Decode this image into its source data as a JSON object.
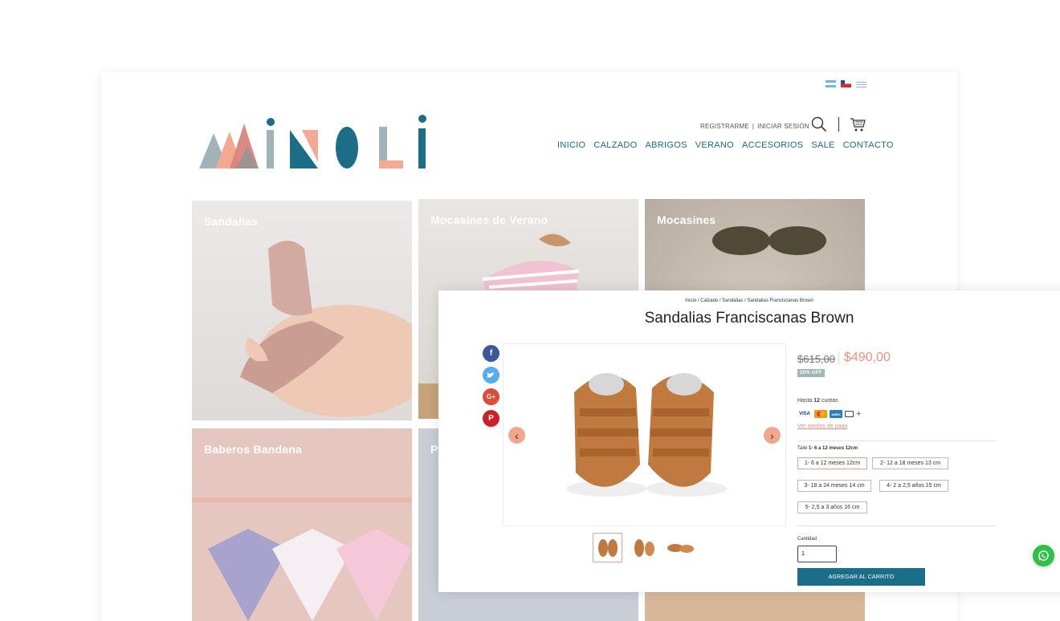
{
  "brand": {
    "logo_text": "MINOLI",
    "colors": {
      "teal": "#1c6d88",
      "salmon": "#f0907a",
      "grey_blue": "#9fb3b8"
    }
  },
  "header": {
    "account": {
      "register": "REGISTRARME",
      "separator": "|",
      "login": "INICIAR SESIÓN"
    },
    "icons": [
      "search-icon",
      "cart-icon"
    ],
    "flags": [
      "argentina-flag",
      "chile-flag",
      "uruguay-flag"
    ],
    "nav": [
      "INICIO",
      "CALZADO",
      "ABRIGOS",
      "VERANO",
      "ACCESORIOS",
      "SALE",
      "CONTACTO"
    ]
  },
  "categories": [
    {
      "title": "Sandalias"
    },
    {
      "title": "Mocasines de Verano"
    },
    {
      "title": "Mocasines"
    },
    {
      "title": "Baberos Bandana"
    },
    {
      "title": "P"
    },
    {
      "title": ""
    }
  ],
  "product": {
    "breadcrumb": "Inicio / Calzado / Sandalias / Sandalias Franciscanas Brown",
    "title": "Sandalias Franciscanas Brown",
    "price_old": "$615,00",
    "price_new": "$490,00",
    "discount_badge": "20% OFF",
    "installments_prefix": "Hasta",
    "installments_count": "12",
    "installments_suffix": "cuotas",
    "payment_link": "Ver medios de pago",
    "size": {
      "label": "Talle",
      "selected": "1- 6 a 12 meses 12cm",
      "options": [
        "1- 6 a 12 meses 12cm",
        "2- 12 a 18 meses 13 cm",
        "3- 18 a 24 meses 14 cm",
        "4- 2 a 2,5 años 15 cm",
        "5- 2,5 a 3 años 16 cm"
      ]
    },
    "quantity": {
      "label": "Cantidad",
      "value": "1"
    },
    "add_to_cart": "AGREGAR AL CARRITO",
    "share": [
      "facebook-icon",
      "twitter-icon",
      "google-plus-icon",
      "pinterest-icon"
    ],
    "payment_cards": {
      "visa": "VISA",
      "amex": "AMEX"
    }
  }
}
